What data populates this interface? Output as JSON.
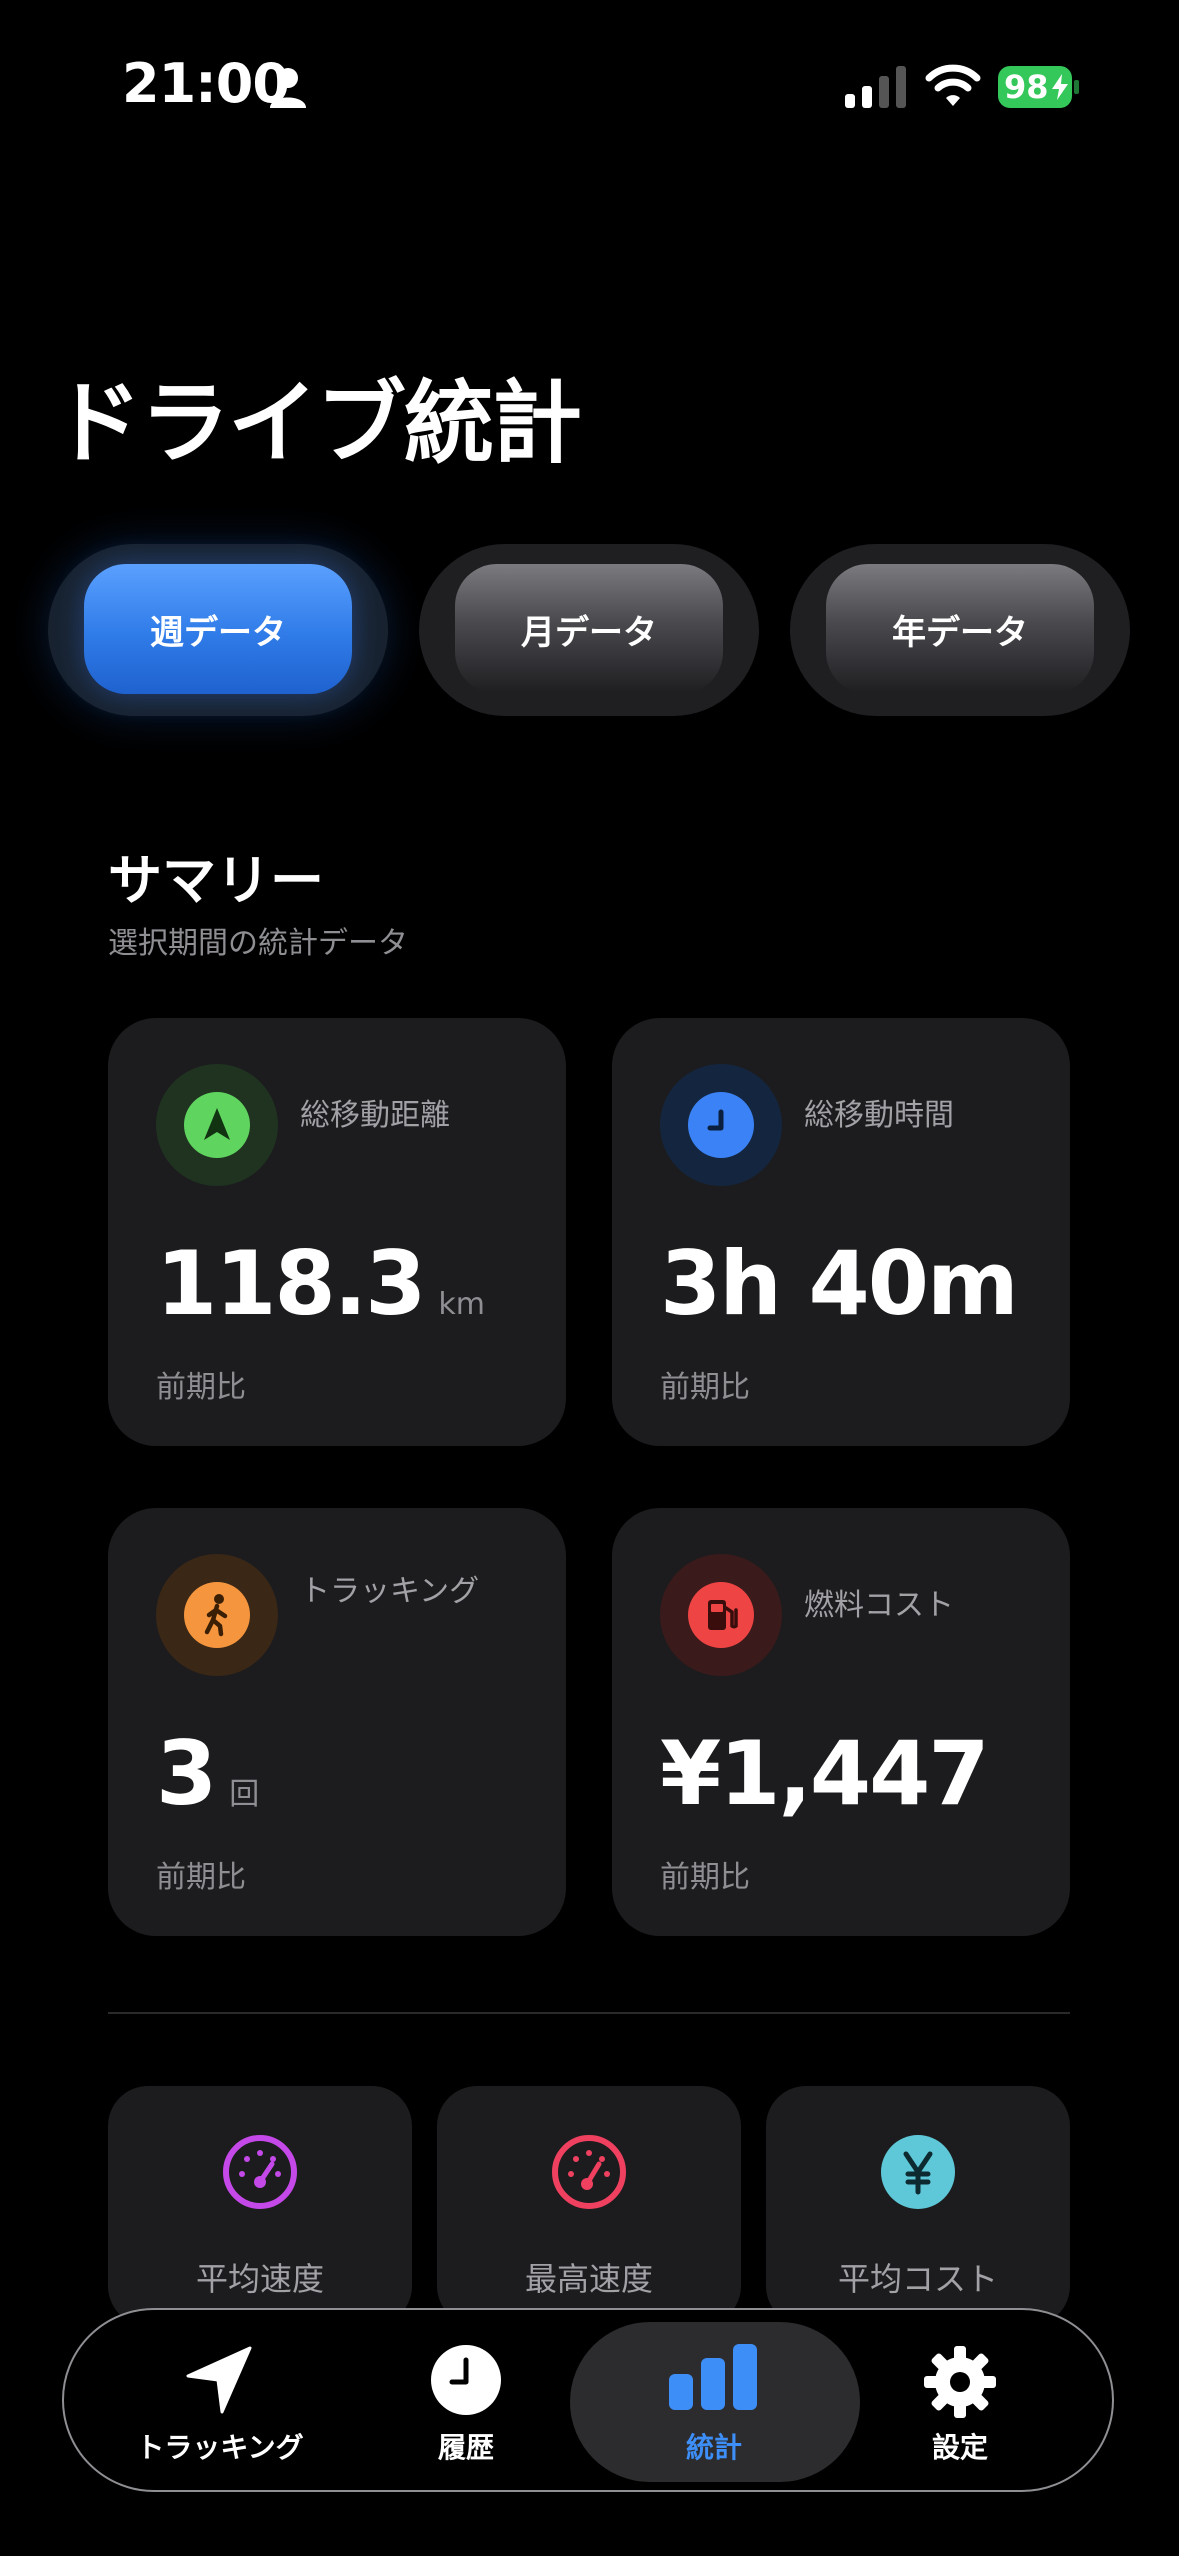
{
  "status_bar": {
    "time": "21:00",
    "battery": "98"
  },
  "page": {
    "title": "ドライブ統計"
  },
  "periods": [
    {
      "label": "週データ",
      "active": true
    },
    {
      "label": "月データ",
      "active": false
    },
    {
      "label": "年データ",
      "active": false
    }
  ],
  "summary": {
    "title": "サマリー",
    "subtitle": "選択期間の統計データ"
  },
  "stats": {
    "distance": {
      "label": "総移動距離",
      "value": "118.3",
      "unit": "km",
      "compare": "前期比",
      "icon": "location-arrow-icon",
      "color": "#5fd45f"
    },
    "time": {
      "label": "総移動時間",
      "value": "3h 40m",
      "compare": "前期比",
      "icon": "clock-icon",
      "color": "#3b82f6"
    },
    "tracking": {
      "label": "トラッキング",
      "value": "3",
      "unit": "回",
      "compare": "前期比",
      "icon": "walking-person-icon",
      "color": "#f5963f"
    },
    "fuel": {
      "label": "燃料コスト",
      "value": "¥1,447",
      "compare": "前期比",
      "icon": "fuel-pump-icon",
      "color": "#ef4444"
    }
  },
  "mini_stats": [
    {
      "label": "平均速度",
      "icon": "speedometer-icon",
      "color": "#c449e8"
    },
    {
      "label": "最高速度",
      "icon": "gauge-icon",
      "color": "#ef4060"
    },
    {
      "label": "平均コスト",
      "icon": "yen-icon",
      "color": "#5ec8d8"
    }
  ],
  "tabbar": [
    {
      "label": "トラッキング",
      "icon": "navigation-arrow-icon",
      "active": false
    },
    {
      "label": "履歴",
      "icon": "clock-icon",
      "active": false
    },
    {
      "label": "統計",
      "icon": "bar-chart-icon",
      "active": true
    },
    {
      "label": "設定",
      "icon": "gear-icon",
      "active": false
    }
  ]
}
